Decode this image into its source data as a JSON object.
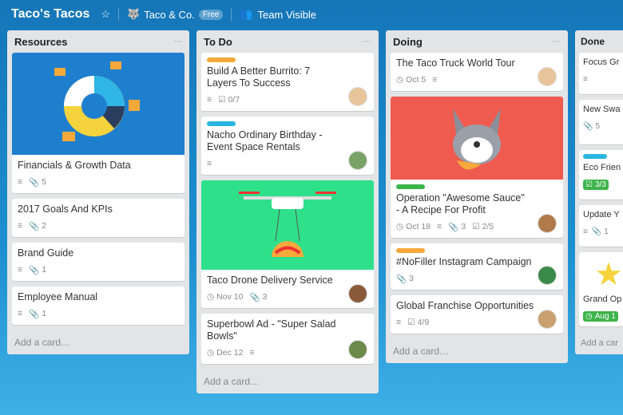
{
  "header": {
    "board_title": "Taco's Tacos",
    "team": "Taco & Co.",
    "plan_badge": "Free",
    "visibility": "Team Visible"
  },
  "colors": {
    "label_orange": "#f6a93b",
    "label_blue": "#29b4e0",
    "label_green": "#3cb44a",
    "badge_green": "#3cb44a"
  },
  "lists": [
    {
      "title": "Resources",
      "add": "Add a card…",
      "cards": [
        {
          "title": "Financials & Growth Data",
          "attachments": "5",
          "cover": "chart"
        },
        {
          "title": "2017 Goals And KPIs",
          "attachments": "2"
        },
        {
          "title": "Brand Guide",
          "attachments": "1"
        },
        {
          "title": "Employee Manual",
          "attachments": "1"
        }
      ]
    },
    {
      "title": "To Do",
      "add": "Add a card…",
      "cards": [
        {
          "title": "Build A Better Burrito: 7 Layers To Success",
          "checklist": "0/7"
        },
        {
          "title": "Nacho Ordinary Birthday - Event Space Rentals"
        },
        {
          "title": "Taco Drone Delivery Service",
          "due": "Nov 10",
          "attachments": "3",
          "cover": "drone"
        },
        {
          "title": "Superbowl Ad - \"Super Salad Bowls\"",
          "due": "Dec 12"
        }
      ]
    },
    {
      "title": "Doing",
      "add": "Add a card…",
      "cards": [
        {
          "title": "The Taco Truck World Tour",
          "due": "Oct 5"
        },
        {
          "title": "Operation \"Awesome Sauce\" - A Recipe For Profit",
          "due": "Oct 18",
          "attachments": "3",
          "checklist": "2/5",
          "cover": "husky"
        },
        {
          "title": "#NoFiller Instagram Campaign",
          "attachments": "3"
        },
        {
          "title": "Global Franchise Opportunities",
          "checklist": "4/9"
        }
      ]
    },
    {
      "title": "Done",
      "add": "Add a car",
      "cards": [
        {
          "title": "Focus Gr"
        },
        {
          "title": "New Swa",
          "attachments": "5"
        },
        {
          "title": "Eco Frien",
          "checklist": "3/3"
        },
        {
          "title": "Update Y",
          "attachments": "1"
        },
        {
          "title": "Grand Op",
          "due": "Aug 1"
        }
      ]
    }
  ]
}
